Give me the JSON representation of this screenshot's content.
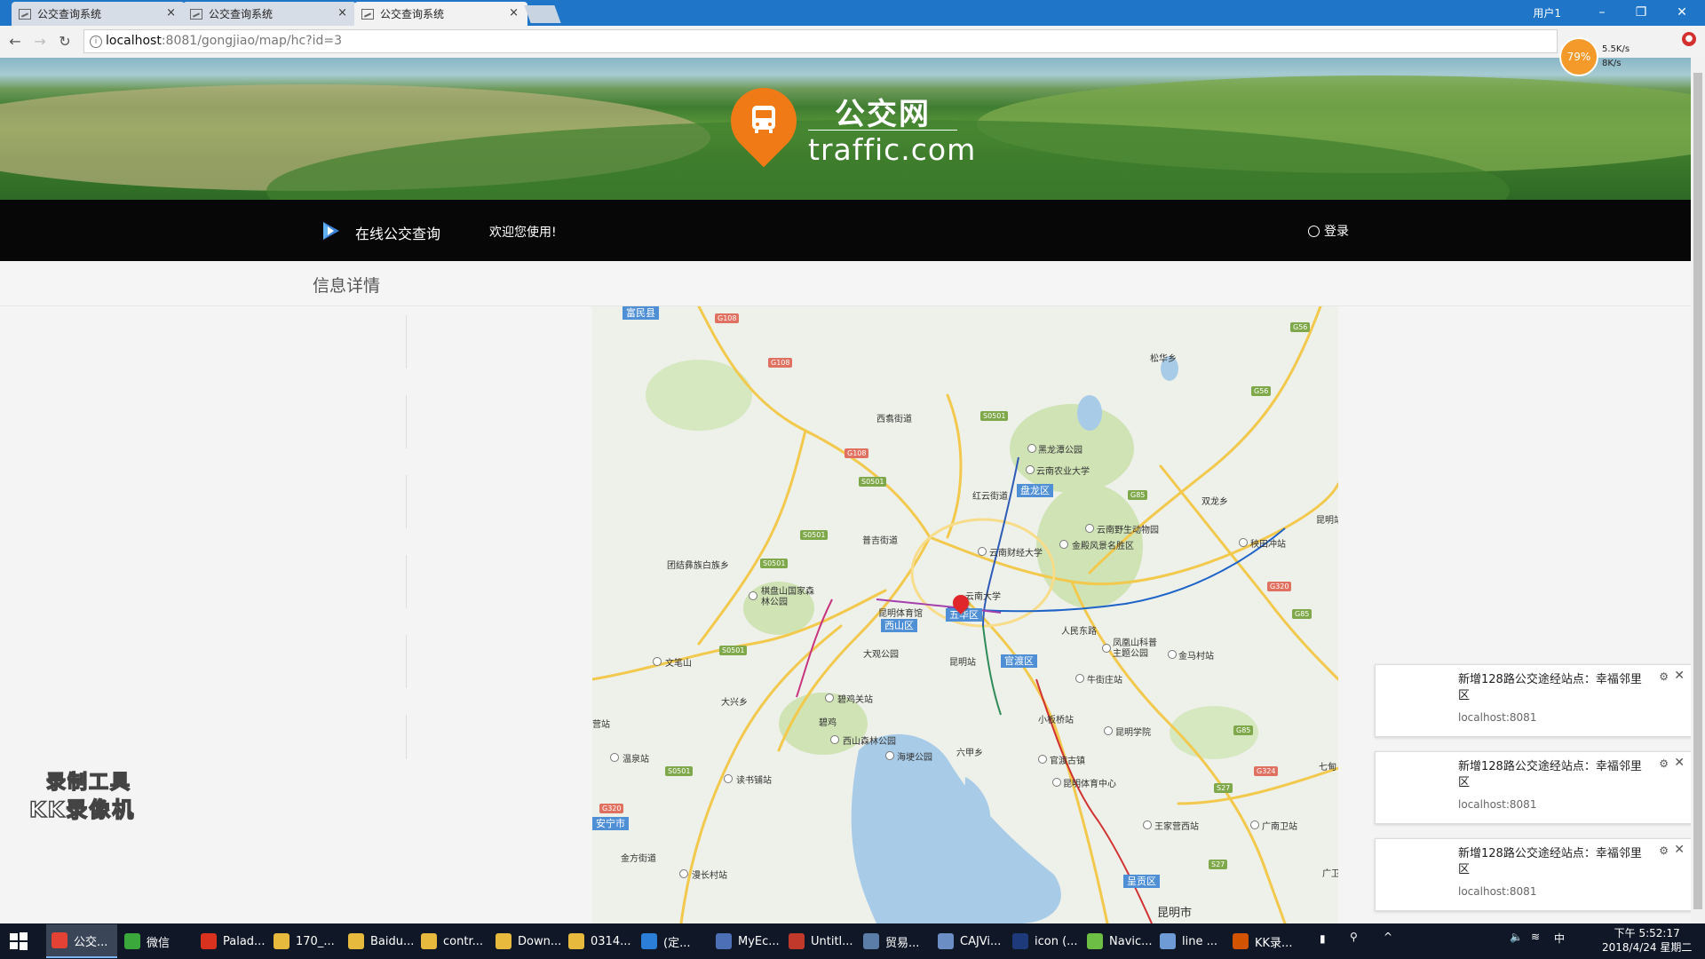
{
  "browser": {
    "tabs": [
      {
        "title": "公交查询系统",
        "close": "×"
      },
      {
        "title": "公交查询系统",
        "close": "×"
      },
      {
        "title": "公交查询系统",
        "close": "×"
      }
    ],
    "window_user": "用户1",
    "window_buttons": {
      "minimize": "–",
      "restore": "❐",
      "close": "✕"
    },
    "url_host": "localhost",
    "url_path": ":8081/gongjiao/map/hc?id=3",
    "speed": {
      "percent": "79%",
      "up": "5.5K/s",
      "down": "8K/s"
    }
  },
  "header": {
    "logo_cn": "公交网",
    "logo_en": "traffic.com"
  },
  "nav": {
    "brand": "在线公交查询",
    "welcome": "欢迎您使用!",
    "login": "登录"
  },
  "page": {
    "title": "信息详情"
  },
  "map": {
    "labels": [
      {
        "text": "富民县",
        "kind": "district"
      },
      {
        "text": "松华乡"
      },
      {
        "text": "西翥街道"
      },
      {
        "text": "黑龙潭公园"
      },
      {
        "text": "云南农业大学"
      },
      {
        "text": "红云街道"
      },
      {
        "text": "盘龙区",
        "kind": "district"
      },
      {
        "text": "双龙乡"
      },
      {
        "text": "云南野生动物园"
      },
      {
        "text": "金殿风景名胜区"
      },
      {
        "text": "昆明站"
      },
      {
        "text": "普吉街道"
      },
      {
        "text": "云南财经大学"
      },
      {
        "text": "秧田冲站"
      },
      {
        "text": "团结彝族白族乡"
      },
      {
        "text": "棋盘山国家森林公园"
      },
      {
        "text": "云南大学"
      },
      {
        "text": "昆明体育馆"
      },
      {
        "text": "五华区",
        "kind": "district"
      },
      {
        "text": "西山区",
        "kind": "district"
      },
      {
        "text": "人民东路"
      },
      {
        "text": "凤凰山科普主题公园"
      },
      {
        "text": "金马村站"
      },
      {
        "text": "文笔山"
      },
      {
        "text": "大观公园"
      },
      {
        "text": "昆明站"
      },
      {
        "text": "官渡区",
        "kind": "district"
      },
      {
        "text": "牛街庄站"
      },
      {
        "text": "碧鸡关站"
      },
      {
        "text": "大兴乡"
      },
      {
        "text": "小板桥站"
      },
      {
        "text": "昆明学院"
      },
      {
        "text": "西山森林公园"
      },
      {
        "text": "海埂公园"
      },
      {
        "text": "六甲乡"
      },
      {
        "text": "官渡古镇"
      },
      {
        "text": "温泉站"
      },
      {
        "text": "读书铺站"
      },
      {
        "text": "昆明体育中心"
      },
      {
        "text": "安宁市",
        "kind": "district"
      },
      {
        "text": "王家营西站"
      },
      {
        "text": "广南卫站"
      },
      {
        "text": "金方街道"
      },
      {
        "text": "漫长村站"
      },
      {
        "text": "呈贡区",
        "kind": "district"
      },
      {
        "text": "昆明市"
      },
      {
        "text": "七甸"
      },
      {
        "text": "广卫"
      },
      {
        "text": "碧鸡"
      },
      {
        "text": "营站"
      }
    ],
    "road_signs": [
      "G108",
      "G108",
      "G108",
      "S0501",
      "S0501",
      "S0501",
      "S0501",
      "S0501",
      "S0501",
      "G56",
      "G56",
      "G85",
      "G85",
      "G85",
      "G320",
      "G320",
      "G324",
      "S27",
      "S27"
    ]
  },
  "watermark": {
    "line1": "录制工具",
    "line2": "KK录像机"
  },
  "notifications": [
    {
      "title": "新增128路公交途经站点：幸福邻里区",
      "source": "localhost:8081"
    },
    {
      "title": "新增128路公交途经站点：幸福邻里区",
      "source": "localhost:8081"
    },
    {
      "title": "新增128路公交途经站点：幸福邻里区",
      "source": "localhost:8081"
    }
  ],
  "taskbar": {
    "items": [
      {
        "label": "公交...",
        "color": "#e34234"
      },
      {
        "label": "微信",
        "color": "#3aa83a"
      },
      {
        "label": "Palad...",
        "color": "#d9321f"
      },
      {
        "label": "170_...",
        "color": "#e7b93c"
      },
      {
        "label": "Baidu...",
        "color": "#e7b93c"
      },
      {
        "label": "contr...",
        "color": "#e7b93c"
      },
      {
        "label": "Down...",
        "color": "#e7b93c"
      },
      {
        "label": "0314...",
        "color": "#e7b93c"
      },
      {
        "label": "(定...",
        "color": "#2b7fd6"
      },
      {
        "label": "MyEc...",
        "color": "#4c6fb5"
      },
      {
        "label": "Untitl...",
        "color": "#c0392b"
      },
      {
        "label": "贸易...",
        "color": "#5b7ea8"
      },
      {
        "label": "CAJVi...",
        "color": "#6b8fc4"
      },
      {
        "label": "icon (...",
        "color": "#1f3a7a"
      },
      {
        "label": "Navic...",
        "color": "#6cbe45"
      },
      {
        "label": "line ...",
        "color": "#6e9ad6"
      },
      {
        "label": "KK录...",
        "color": "#d35400"
      }
    ],
    "tray_ime": "中",
    "time": "下午 5:52:17",
    "date": "2018/4/24 星期二"
  }
}
